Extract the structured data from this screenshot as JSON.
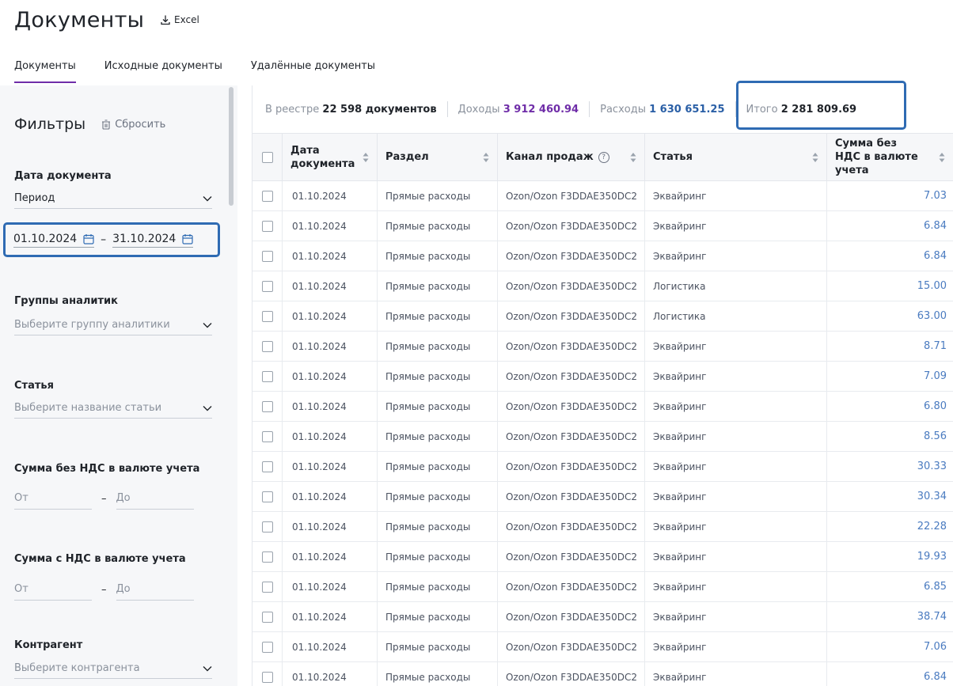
{
  "header": {
    "title": "Документы",
    "excel_label": "Excel"
  },
  "tabs": [
    {
      "label": "Документы",
      "active": true
    },
    {
      "label": "Исходные документы",
      "active": false
    },
    {
      "label": "Удалённые документы",
      "active": false
    }
  ],
  "filters": {
    "title": "Фильтры",
    "reset_label": "Сбросить",
    "doc_date": {
      "label": "Дата документа",
      "period_value": "Период",
      "date_from": "01.10.2024",
      "date_to": "31.10.2024",
      "dash": "–"
    },
    "analytics": {
      "label": "Группы аналитик",
      "placeholder": "Выберите группу аналитики"
    },
    "article": {
      "label": "Статья",
      "placeholder": "Выберите название статьи"
    },
    "sum_no_vat": {
      "label": "Сумма без НДС в валюте учета",
      "from": "От",
      "to": "До",
      "dash": "–"
    },
    "sum_vat": {
      "label": "Сумма с НДС в валюте учета",
      "from": "От",
      "to": "До",
      "dash": "–"
    },
    "counterparty": {
      "label": "Контрагент",
      "placeholder": "Выберите контрагента"
    }
  },
  "summary": {
    "count_label": "В реестре",
    "count_value": "22 598 документов",
    "income_label": "Доходы",
    "income_value": "3 912 460.94",
    "expense_label": "Расходы",
    "expense_value": "1 630 651.25",
    "total_label": "Итого",
    "total_value": "2 281 809.69"
  },
  "table": {
    "columns": [
      "Дата документа",
      "Раздел",
      "Канал продаж",
      "Статья",
      "Сумма без НДС в валюте учета"
    ],
    "help_icon": "?",
    "rows": [
      {
        "date": "01.10.2024",
        "section": "Прямые расходы",
        "channel": "Ozon/Ozon F3DDAE350DC2",
        "article": "Эквайринг",
        "amount": "7.03"
      },
      {
        "date": "01.10.2024",
        "section": "Прямые расходы",
        "channel": "Ozon/Ozon F3DDAE350DC2",
        "article": "Эквайринг",
        "amount": "6.84"
      },
      {
        "date": "01.10.2024",
        "section": "Прямые расходы",
        "channel": "Ozon/Ozon F3DDAE350DC2",
        "article": "Эквайринг",
        "amount": "6.84"
      },
      {
        "date": "01.10.2024",
        "section": "Прямые расходы",
        "channel": "Ozon/Ozon F3DDAE350DC2",
        "article": "Логистика",
        "amount": "15.00"
      },
      {
        "date": "01.10.2024",
        "section": "Прямые расходы",
        "channel": "Ozon/Ozon F3DDAE350DC2",
        "article": "Логистика",
        "amount": "63.00"
      },
      {
        "date": "01.10.2024",
        "section": "Прямые расходы",
        "channel": "Ozon/Ozon F3DDAE350DC2",
        "article": "Эквайринг",
        "amount": "8.71"
      },
      {
        "date": "01.10.2024",
        "section": "Прямые расходы",
        "channel": "Ozon/Ozon F3DDAE350DC2",
        "article": "Эквайринг",
        "amount": "7.09"
      },
      {
        "date": "01.10.2024",
        "section": "Прямые расходы",
        "channel": "Ozon/Ozon F3DDAE350DC2",
        "article": "Эквайринг",
        "amount": "6.80"
      },
      {
        "date": "01.10.2024",
        "section": "Прямые расходы",
        "channel": "Ozon/Ozon F3DDAE350DC2",
        "article": "Эквайринг",
        "amount": "8.56"
      },
      {
        "date": "01.10.2024",
        "section": "Прямые расходы",
        "channel": "Ozon/Ozon F3DDAE350DC2",
        "article": "Эквайринг",
        "amount": "30.33"
      },
      {
        "date": "01.10.2024",
        "section": "Прямые расходы",
        "channel": "Ozon/Ozon F3DDAE350DC2",
        "article": "Эквайринг",
        "amount": "30.34"
      },
      {
        "date": "01.10.2024",
        "section": "Прямые расходы",
        "channel": "Ozon/Ozon F3DDAE350DC2",
        "article": "Эквайринг",
        "amount": "22.28"
      },
      {
        "date": "01.10.2024",
        "section": "Прямые расходы",
        "channel": "Ozon/Ozon F3DDAE350DC2",
        "article": "Эквайринг",
        "amount": "19.93"
      },
      {
        "date": "01.10.2024",
        "section": "Прямые расходы",
        "channel": "Ozon/Ozon F3DDAE350DC2",
        "article": "Эквайринг",
        "amount": "6.85"
      },
      {
        "date": "01.10.2024",
        "section": "Прямые расходы",
        "channel": "Ozon/Ozon F3DDAE350DC2",
        "article": "Эквайринг",
        "amount": "38.74"
      },
      {
        "date": "01.10.2024",
        "section": "Прямые расходы",
        "channel": "Ozon/Ozon F3DDAE350DC2",
        "article": "Эквайринг",
        "amount": "7.06"
      },
      {
        "date": "01.10.2024",
        "section": "Прямые расходы",
        "channel": "Ozon/Ozon F3DDAE350DC2",
        "article": "Эквайринг",
        "amount": "6.84"
      }
    ]
  },
  "colors": {
    "accent": "#6f2da8",
    "link": "#4a7bc0",
    "highlight_border": "#2f6bb3"
  }
}
